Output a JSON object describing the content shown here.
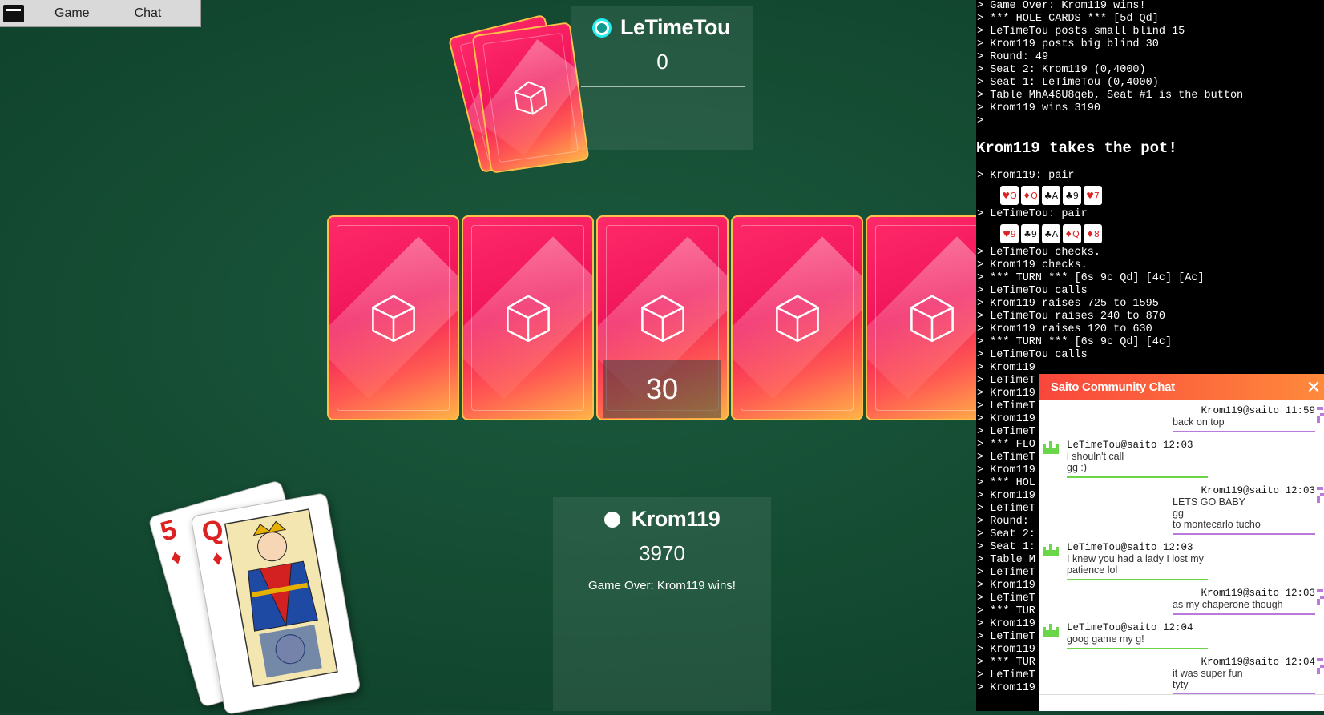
{
  "menu": {
    "items": [
      "Game",
      "Chat"
    ]
  },
  "opponent": {
    "name": "LeTimeTou",
    "chips": "0"
  },
  "player": {
    "name": "Krom119",
    "chips": "3970",
    "status": "Game Over: Krom119 wins!"
  },
  "pot": "30",
  "hand": [
    {
      "rank": "5",
      "suit": "♦"
    },
    {
      "rank": "Q",
      "suit": "♦"
    }
  ],
  "log": {
    "lines_top": [
      "> Game Over: Krom119 wins!",
      "> *** HOLE CARDS *** [5d Qd]",
      "> LeTimeTou posts small blind 15",
      "> Krom119 posts big blind 30",
      "> Round: 49",
      "> Seat 2: Krom119 (0,4000)",
      "> Seat 1: LeTimeTou (0,4000)",
      "> Table MhA46U8qeb, Seat #1 is the button",
      "> Krom119 wins 3190",
      ">"
    ],
    "headline": "Krom119 takes the pot!",
    "hand1_label": "> Krom119: pair",
    "hand1_cards": [
      {
        "t": "♥Q",
        "c": "red"
      },
      {
        "t": "♦Q",
        "c": "red"
      },
      {
        "t": "♣A",
        "c": "black"
      },
      {
        "t": "♣9",
        "c": "black"
      },
      {
        "t": "♥7",
        "c": "red"
      }
    ],
    "hand2_label": "> LeTimeTou: pair",
    "hand2_cards": [
      {
        "t": "♥9",
        "c": "red"
      },
      {
        "t": "♣9",
        "c": "black"
      },
      {
        "t": "♣A",
        "c": "black"
      },
      {
        "t": "♦Q",
        "c": "red"
      },
      {
        "t": "♦8",
        "c": "red"
      }
    ],
    "lines_bottom": [
      "> LeTimeTou checks.",
      "> Krom119 checks.",
      "> *** TURN *** [6s 9c Qd] [4c] [Ac]",
      "> LeTimeTou calls",
      "> Krom119 raises 725 to 1595",
      "> LeTimeTou raises 240 to 870",
      "> Krom119 raises 120 to 630",
      "> *** TURN *** [6s 9c Qd] [4c]",
      "> LeTimeTou calls",
      "> Krom119",
      "> LeTimeT",
      "> Krom119",
      "> LeTimeT",
      "> Krom119",
      "> LeTimeT",
      "> *** FLO",
      "> LeTimeT",
      "> Krom119",
      "> *** HOL",
      "> Krom119",
      "> LeTimeT",
      "> Round:",
      "> Seat 2:",
      "> Seat 1:",
      "> Table M",
      "> LeTimeT",
      "> Krom119",
      "> LeTimeT",
      "> *** TUR",
      "> Krom119",
      "> LeTimeT",
      "> Krom119",
      "> *** TUR",
      "> LeTimeT",
      "> Krom119"
    ]
  },
  "chat": {
    "title": "Saito Community Chat",
    "close": "✕",
    "messages": [
      {
        "side": "right",
        "who": "Krom119@saito",
        "time": "11:59",
        "lines": [
          "back on top"
        ]
      },
      {
        "side": "left",
        "who": "LeTimeTou@saito",
        "time": "12:03",
        "lines": [
          "i shouln't call",
          "gg :)"
        ]
      },
      {
        "side": "right",
        "who": "Krom119@saito",
        "time": "12:03",
        "lines": [
          "LETS GO BABY",
          "gg",
          "to montecarlo tucho"
        ]
      },
      {
        "side": "left",
        "who": "LeTimeTou@saito",
        "time": "12:03",
        "lines": [
          "I knew you had a lady I lost my patience lol"
        ]
      },
      {
        "side": "right",
        "who": "Krom119@saito",
        "time": "12:03",
        "lines": [
          "as my chaperone though"
        ]
      },
      {
        "side": "left",
        "who": "LeTimeTou@saito",
        "time": "12:04",
        "lines": [
          "goog game my g!"
        ]
      },
      {
        "side": "right",
        "who": "Krom119@saito",
        "time": "12:04",
        "lines": [
          "it was super fun",
          "tyty"
        ]
      }
    ]
  },
  "colors": {
    "felt": "#134a31",
    "cardback": "#f0155a",
    "chat_header": "#f9463c",
    "left_line": "#6bd64a",
    "right_line": "#b97ad9"
  }
}
